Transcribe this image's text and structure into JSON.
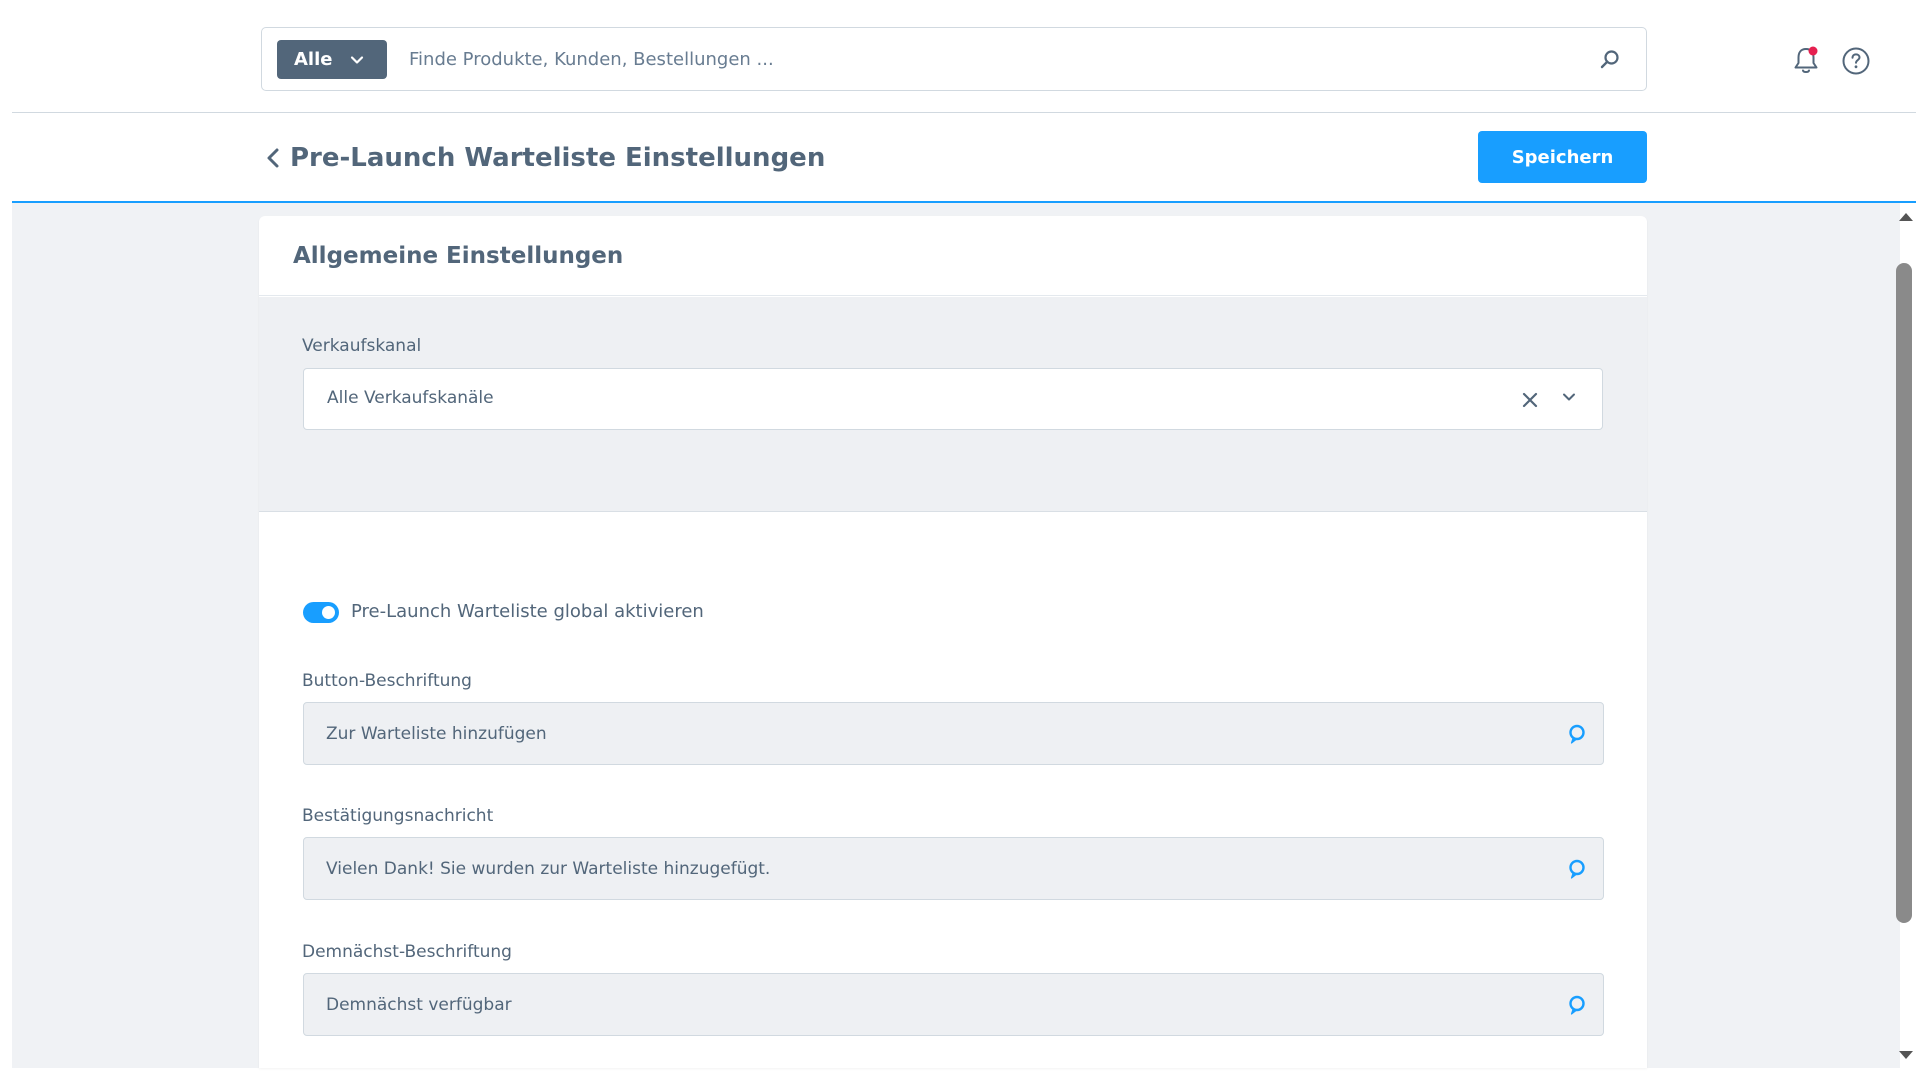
{
  "search": {
    "type_label": "Alle",
    "placeholder": "Finde Produkte, Kunden, Bestellungen ..."
  },
  "header": {
    "title": "Pre-Launch Warteliste Einstellungen",
    "save_label": "Speichern"
  },
  "card": {
    "title": "Allgemeine Einstellungen",
    "sales_channel": {
      "label": "Verkaufskanal",
      "value": "Alle Verkaufskanäle"
    },
    "toggle": {
      "label": "Pre-Launch Warteliste global aktivieren",
      "enabled": true
    },
    "fields": [
      {
        "label": "Button-Beschriftung",
        "value": "Zur Warteliste hinzufügen"
      },
      {
        "label": "Bestätigungsnachricht",
        "value": "Vielen Dank! Sie wurden zur Warteliste hinzugefügt."
      },
      {
        "label": "Demnächst-Beschriftung",
        "value": "Demnächst verfügbar"
      }
    ]
  },
  "icons": {
    "search": "search-icon",
    "bell": "bell-icon",
    "help": "help-icon",
    "back": "chevron-left-icon",
    "clear": "close-icon",
    "dropdown": "chevron-down-icon",
    "translate": "translate-icon"
  },
  "colors": {
    "primary": "#189eff",
    "text": "#52667a",
    "notification_dot": "#e52050",
    "background": "#f0f2f5"
  }
}
